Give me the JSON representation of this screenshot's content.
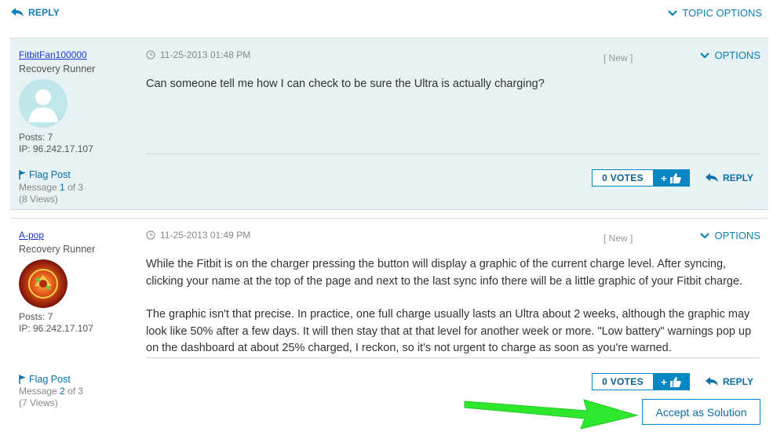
{
  "top": {
    "reply_label": "REPLY",
    "topic_options_label": "TOPIC OPTIONS"
  },
  "posts": [
    {
      "author": "FitbitFan100000",
      "rank": "Recovery Runner",
      "posts": "Posts: 7",
      "ip": "IP: 96.242.17.107",
      "flag": "Flag Post",
      "message_prefix": "Message",
      "message_num": "1",
      "message_suffix": "of 3",
      "views": "(8 Views)",
      "timestamp": "11-25-2013 01:48 PM",
      "new_tag": "[ New ]",
      "options": "OPTIONS",
      "body": [
        "Can someone tell me how I can check to be sure the Ultra is actually charging?"
      ],
      "votes": "0 VOTES",
      "vote_plus": "+",
      "reply": "REPLY",
      "avatar": "default-user-avatar"
    },
    {
      "author": "A-pop",
      "rank": "Recovery Runner",
      "posts": "Posts: 7",
      "ip": "IP: 96.242.17.107",
      "flag": "Flag Post",
      "message_prefix": "Message",
      "message_num": "2",
      "message_suffix": "of 3",
      "views": "(7 Views)",
      "timestamp": "11-25-2013 01:49 PM",
      "new_tag": "[ New ]",
      "options": "OPTIONS",
      "body": [
        "While the Fitbit is on the charger pressing the button will display a graphic of the current charge level. After syncing, clicking your name at the top of the page and next to the last sync info there will be a little graphic of your Fitbit charge.",
        "The graphic isn't that precise. In practice, one full charge usually lasts an Ultra about 2 weeks, although the graphic may look like 50% after a few days. It will then stay that at that level for another week or more. \"Low battery\" warnings pop up on the dashboard at about 25% charged, I reckon, so it's not urgent to charge as soon as you're warned."
      ],
      "votes": "0 VOTES",
      "vote_plus": "+",
      "reply": "REPLY",
      "accept": "Accept as Solution",
      "avatar": "orange-emblem-avatar"
    }
  ],
  "colors": {
    "accent": "#0b7fb8",
    "highlight_bg": "#e6f2f4",
    "annotation_arrow": "#2ee82e"
  }
}
